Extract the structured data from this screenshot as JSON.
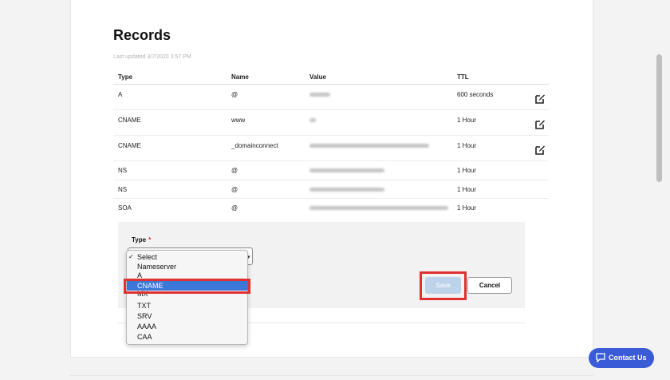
{
  "records": {
    "title": "Records",
    "last_updated": "Last updated 3/7/2020 3:57 PM",
    "columns": [
      "Type",
      "Name",
      "Value",
      "TTL"
    ],
    "rows": [
      {
        "type": "A",
        "name": "@",
        "value": "Parked",
        "ttl": "600 seconds",
        "editable": true
      },
      {
        "type": "CNAME",
        "name": "www",
        "value": "@",
        "ttl": "1 Hour",
        "editable": true
      },
      {
        "type": "CNAME",
        "name": "_domainconnect",
        "value": "_domainconnect.gd.domaincontrol.com",
        "ttl": "1 Hour",
        "editable": true
      },
      {
        "type": "NS",
        "name": "@",
        "value": "ns55.domaincontrol.com",
        "ttl": "1 Hour",
        "editable": false
      },
      {
        "type": "NS",
        "name": "@",
        "value": "ns56.domaincontrol.com",
        "ttl": "1 Hour",
        "editable": false
      },
      {
        "type": "SOA",
        "name": "@",
        "value": "Primary nameserver: ns55.domaincontrol.co...",
        "ttl": "1 Hour",
        "editable": false
      }
    ]
  },
  "add_record": {
    "type_label": "Type",
    "required_marker": "*",
    "type_options": [
      "Select",
      "Nameserver",
      "A",
      "CNAME",
      "MX",
      "TXT",
      "SRV",
      "AAAA",
      "CAA"
    ],
    "checked_option": "Select",
    "highlighted_option": "CNAME",
    "save_label": "Save",
    "cancel_label": "Cancel"
  },
  "contact": {
    "label": "Contact Us"
  },
  "colors": {
    "accent": "#3a5bd6",
    "highlight": "#e03030",
    "selection": "#3b78d8"
  },
  "icons": {
    "edit": "edit-icon",
    "chat": "chat-icon"
  }
}
